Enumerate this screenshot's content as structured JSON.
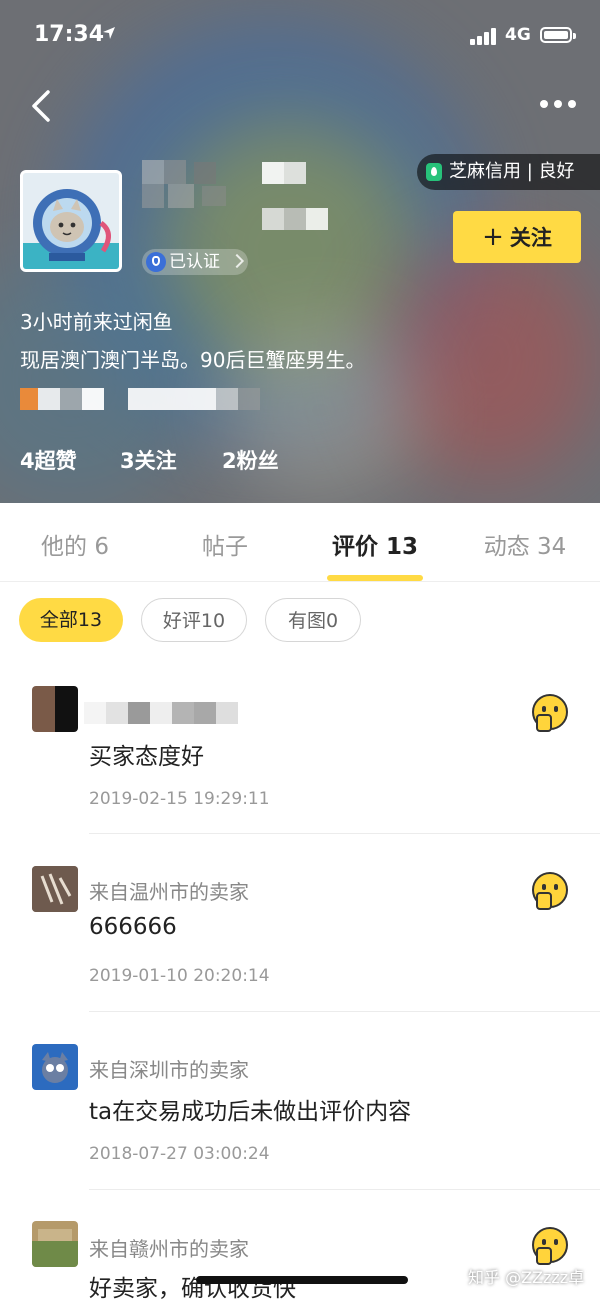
{
  "status_bar": {
    "time": "17:34",
    "network": "4G"
  },
  "credit": {
    "label": "芝麻信用 | 良好"
  },
  "profile": {
    "verified_label": "已认证",
    "follow_label": "关注",
    "last_seen": "3小时前来过闲鱼",
    "bio": "现居澳门澳门半岛。90后巨蟹座男生。",
    "stats": [
      {
        "label": "4超赞"
      },
      {
        "label": "3关注"
      },
      {
        "label": "2粉丝"
      }
    ]
  },
  "tabs": [
    {
      "label": "他的 6"
    },
    {
      "label": "帖子"
    },
    {
      "label": "评价 13"
    },
    {
      "label": "动态 34"
    }
  ],
  "filters": [
    {
      "label": "全部13"
    },
    {
      "label": "好评10"
    },
    {
      "label": "有图0"
    }
  ],
  "reviews": [
    {
      "from": "",
      "text": "买家态度好",
      "date": "2019-02-15 19:29:11"
    },
    {
      "from": "来自温州市的卖家",
      "text": "666666",
      "date": "2019-01-10 20:20:14"
    },
    {
      "from": "来自深圳市的卖家",
      "text": "ta在交易成功后未做出评价内容",
      "date": "2018-07-27 03:00:24"
    },
    {
      "from": "来自赣州市的卖家",
      "text": "好卖家，确认收货快",
      "date": ""
    }
  ],
  "watermark": "知乎 @ZZzzz卓",
  "colors": {
    "accent": "#ffda44",
    "credit_green": "#27c27a"
  }
}
